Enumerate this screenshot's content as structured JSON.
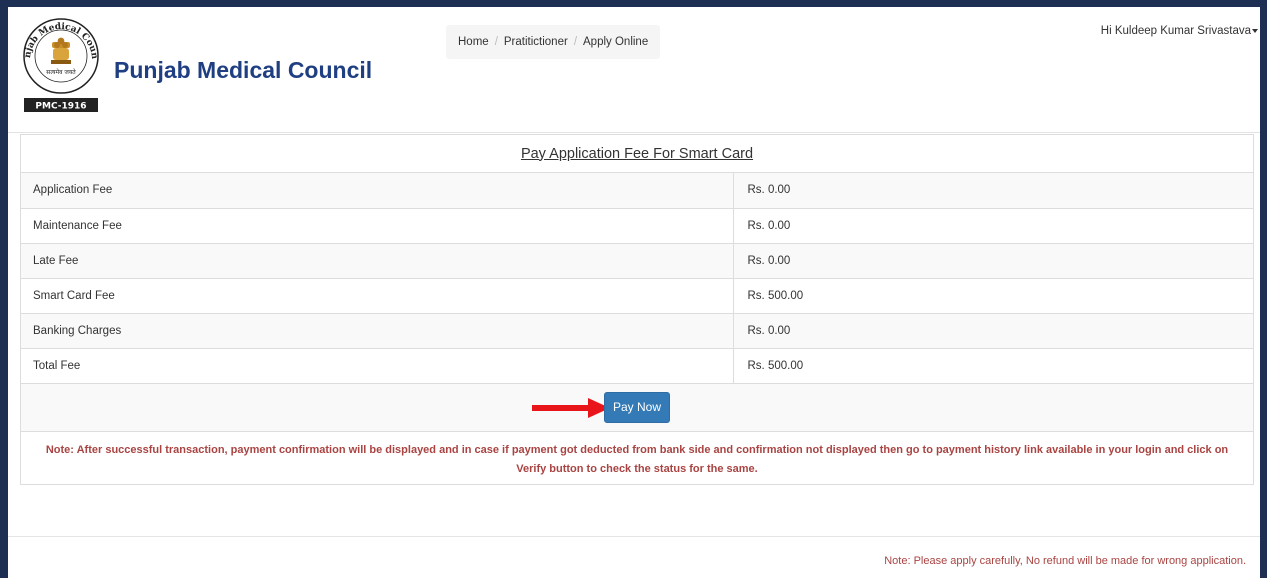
{
  "header": {
    "seal_text_top": "Medical",
    "seal_text_left": "Punjab",
    "seal_text_right": "Council",
    "seal_motto": "सत्यमेव जयते",
    "seal_band": "PMC-1916",
    "brand_name": "Punjab Medical Council",
    "brand_color": "#1f3f82"
  },
  "breadcrumb": {
    "items": [
      "Home",
      "Pratitictioner",
      "Apply Online"
    ],
    "separator": "/"
  },
  "user_menu": {
    "label": "Hi Kuldeep Kumar Srivastava"
  },
  "panel": {
    "title": "Pay Application Fee For Smart Card",
    "fees": [
      {
        "label": "Application Fee",
        "amount": "Rs. 0.00"
      },
      {
        "label": "Maintenance Fee",
        "amount": "Rs. 0.00"
      },
      {
        "label": "Late Fee",
        "amount": "Rs. 0.00"
      },
      {
        "label": "Smart Card Fee",
        "amount": "Rs. 500.00"
      },
      {
        "label": "Banking Charges",
        "amount": "Rs. 0.00"
      },
      {
        "label": "Total Fee",
        "amount": "Rs. 500.00"
      }
    ],
    "pay_button_label": "Pay Now",
    "note": "Note: After successful transaction, payment confirmation will be displayed and in case if payment got deducted from bank side and confirmation not displayed then go to payment history link available in your login and click on Verify button to check the status for the same."
  },
  "footer": {
    "note": "Note: Please apply carefully, No refund will be made for wrong application."
  },
  "colors": {
    "primary_button": "#337ab7",
    "note_red": "#a94442",
    "arrow_red": "#e8161b",
    "outer_border": "#1d2f52"
  }
}
